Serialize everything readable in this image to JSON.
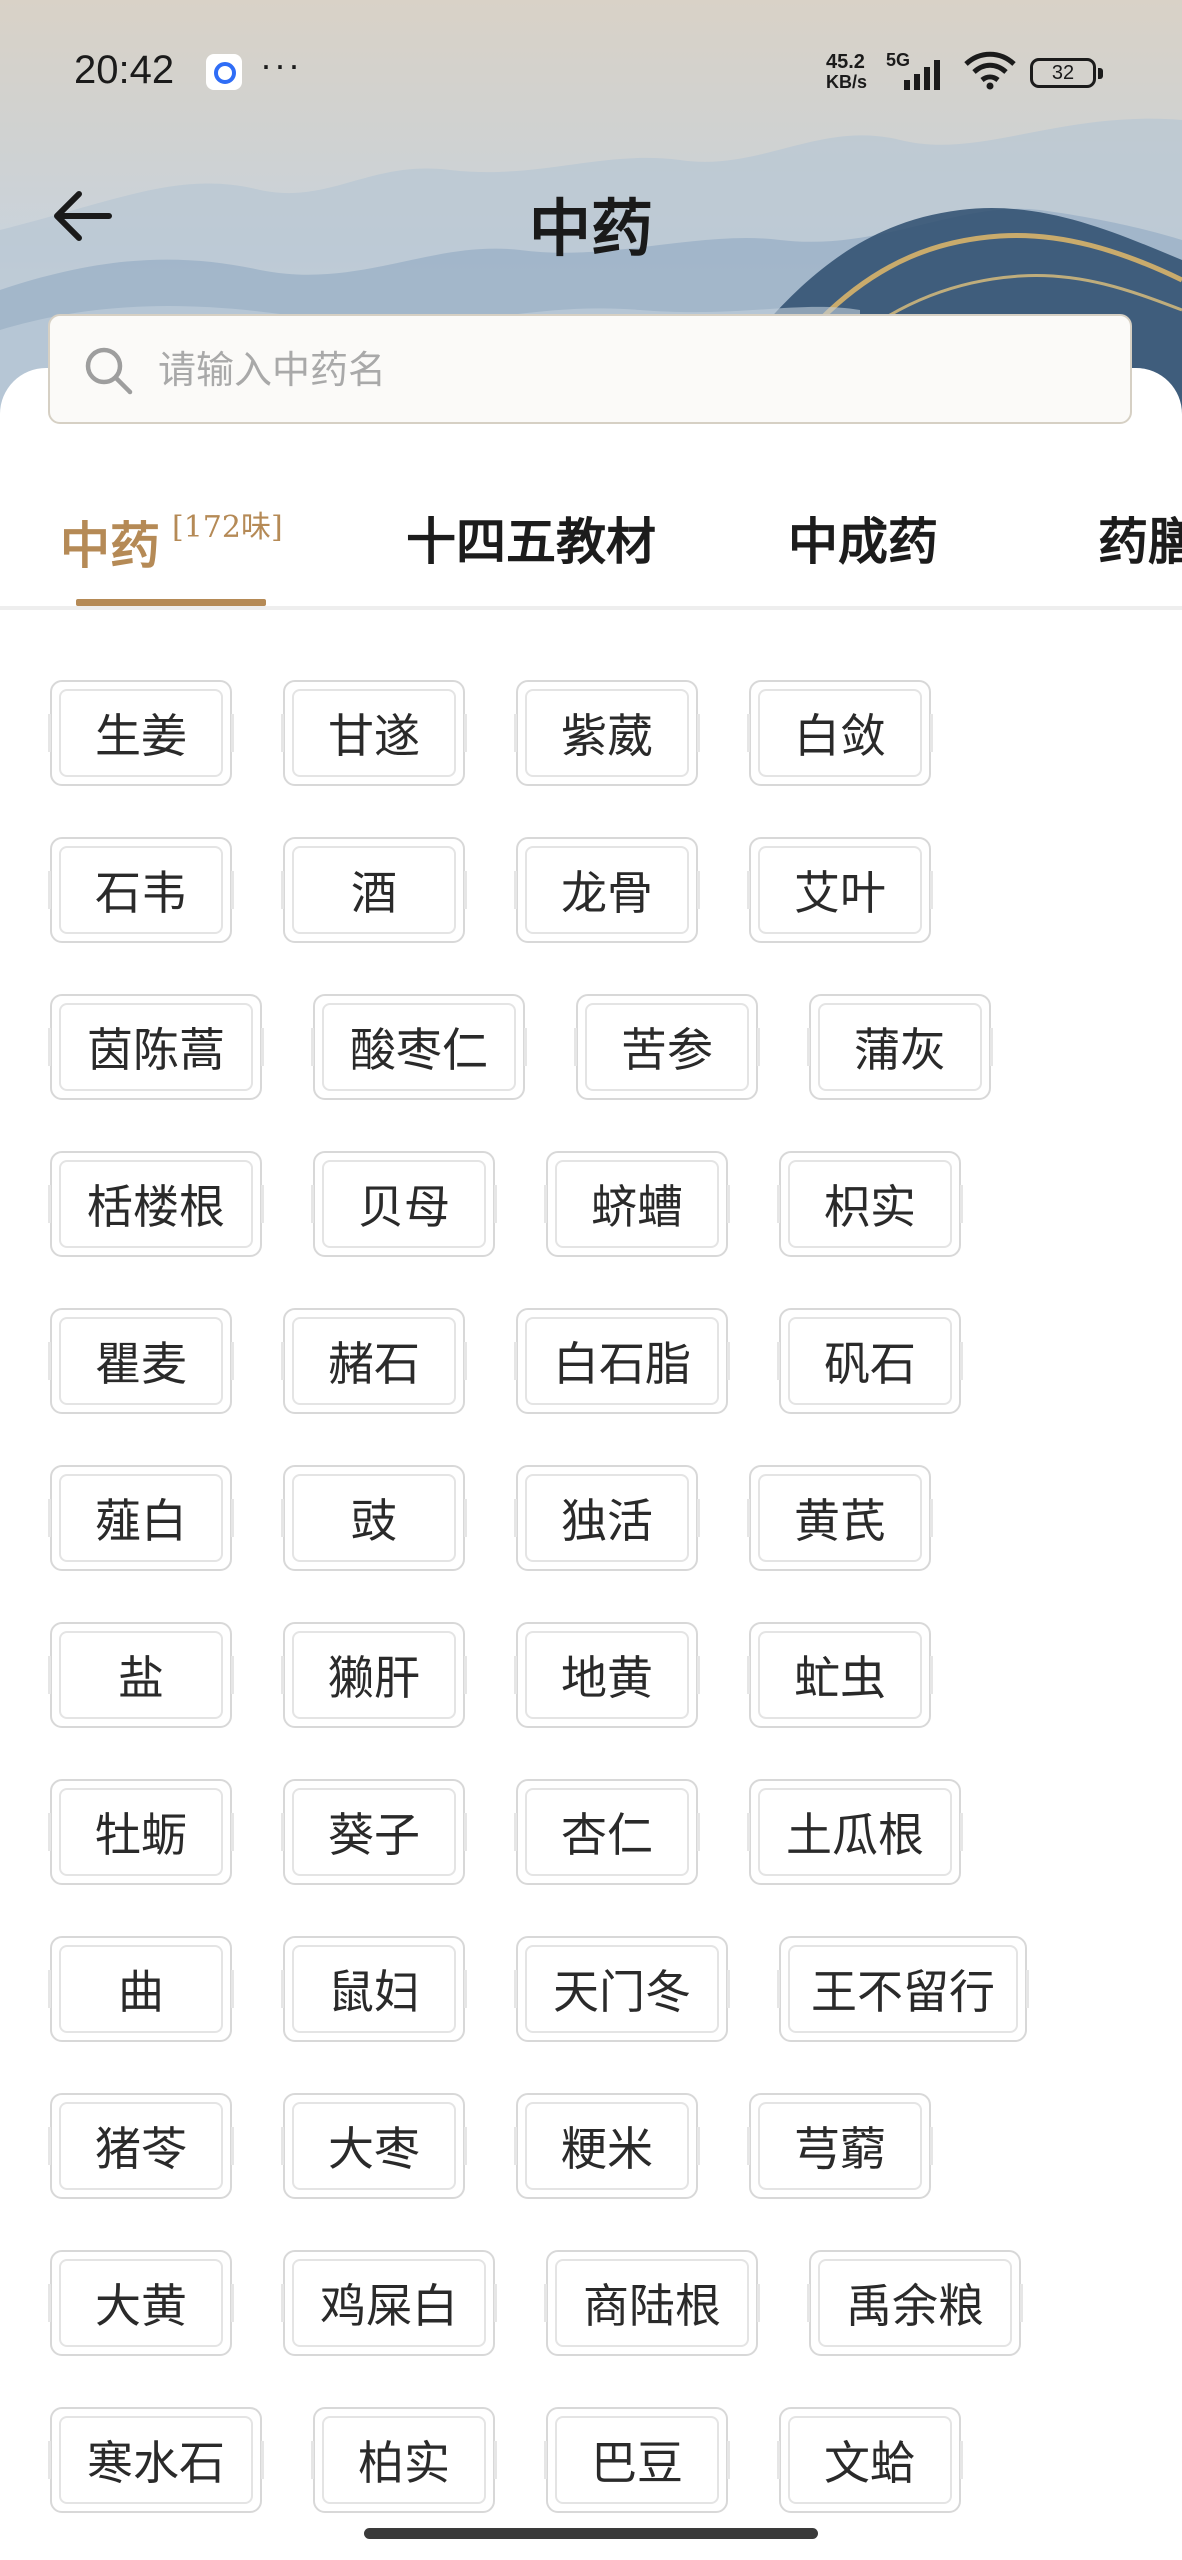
{
  "status_bar": {
    "time": "20:42",
    "net_speed_value": "45.2",
    "net_speed_unit": "KB/s",
    "network_type": "5G",
    "battery": "32"
  },
  "header": {
    "title": "中药"
  },
  "search": {
    "placeholder": "请输入中药名",
    "value": ""
  },
  "tabs": [
    {
      "label": "中药",
      "count": "[172味]",
      "active": true
    },
    {
      "label": "十四五教材",
      "active": false
    },
    {
      "label": "中成药",
      "active": false
    },
    {
      "label": "药膳",
      "active": false
    }
  ],
  "herb_rows": [
    [
      "生姜",
      "甘遂",
      "紫葳",
      "白敛"
    ],
    [
      "石韦",
      "酒",
      "龙骨",
      "艾叶"
    ],
    [
      "茵陈蒿",
      "酸枣仁",
      "苦参",
      "蒲灰"
    ],
    [
      "栝楼根",
      "贝母",
      "蛴螬",
      "枳实"
    ],
    [
      "瞿麦",
      "赭石",
      "白石脂",
      "矾石"
    ],
    [
      "薤白",
      "豉",
      "独活",
      "黄芪"
    ],
    [
      "盐",
      "獭肝",
      "地黄",
      "虻虫"
    ],
    [
      "牡蛎",
      "葵子",
      "杏仁",
      "土瓜根"
    ],
    [
      "曲",
      "鼠妇",
      "天门冬",
      "王不留行"
    ],
    [
      "猪苓",
      "大枣",
      "粳米",
      "芎藭"
    ],
    [
      "大黄",
      "鸡屎白",
      "商陆根",
      "禹余粮"
    ],
    [
      "寒水石",
      "柏实",
      "巴豆",
      "文蛤"
    ]
  ],
  "colors": {
    "accent": "#b58a56",
    "text": "#1c1c1c",
    "chip_border": "#d8d8d8"
  }
}
